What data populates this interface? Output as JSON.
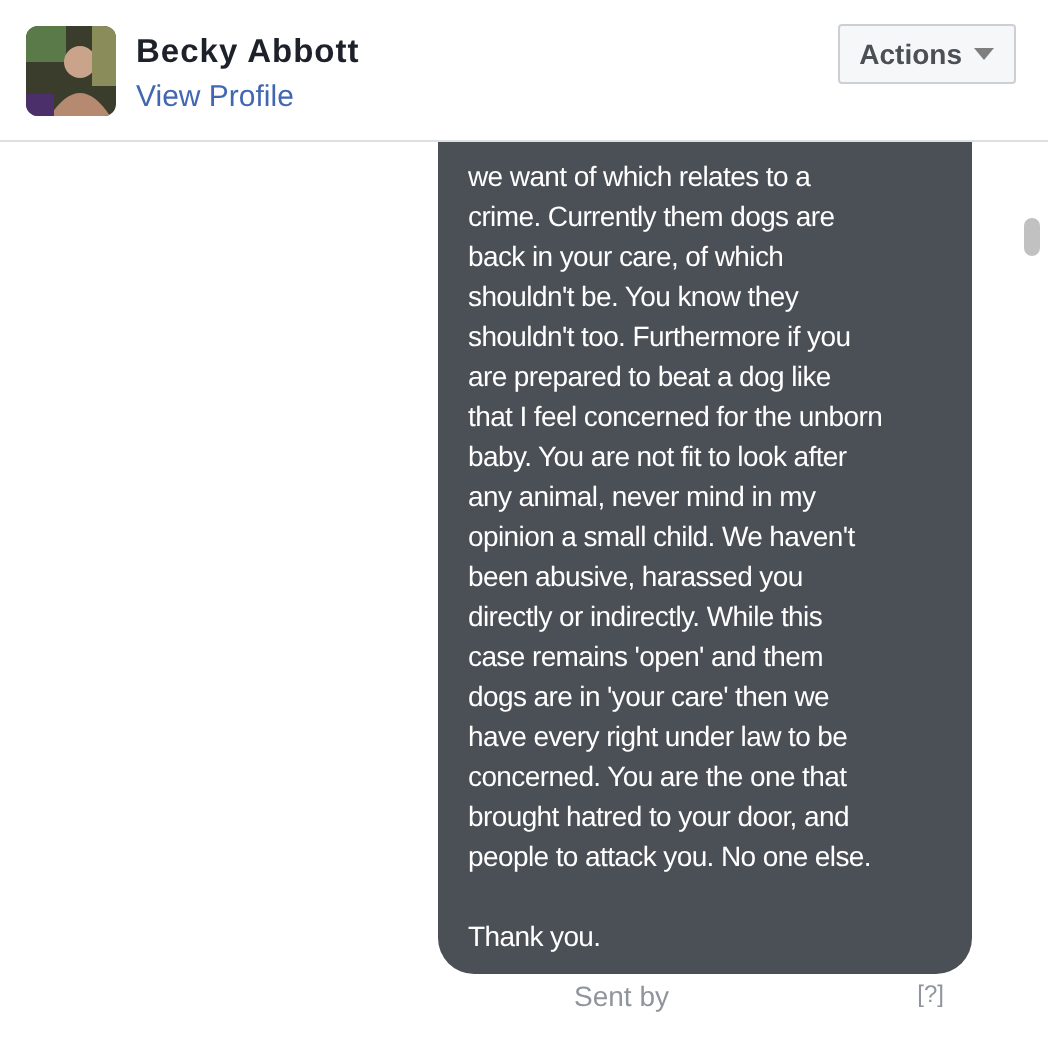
{
  "header": {
    "name": "Becky Abbott",
    "link": "View Profile",
    "actions": "Actions"
  },
  "message": {
    "paragraphs": [
      [
        "we want of which relates to a",
        "crime. Currently them dogs are",
        "back in your care, of which",
        "shouldn't be. You know they",
        "shouldn't too. Furthermore if you",
        "are prepared to beat a dog like",
        "that I feel concerned for the unborn",
        "baby. You are not fit to look after",
        "any animal, never mind in my",
        "opinion a small child. We haven't",
        "been abusive, harassed you",
        "directly or indirectly. While this",
        "case remains 'open' and them",
        "dogs are in 'your care' then we",
        "have every right under law to be",
        "concerned. You are the one that",
        "brought hatred to your door, and",
        "people to attack you. No one else."
      ],
      [
        "Thank you."
      ]
    ]
  },
  "footer": {
    "sent_by": "Sent by",
    "help": "[?]"
  }
}
